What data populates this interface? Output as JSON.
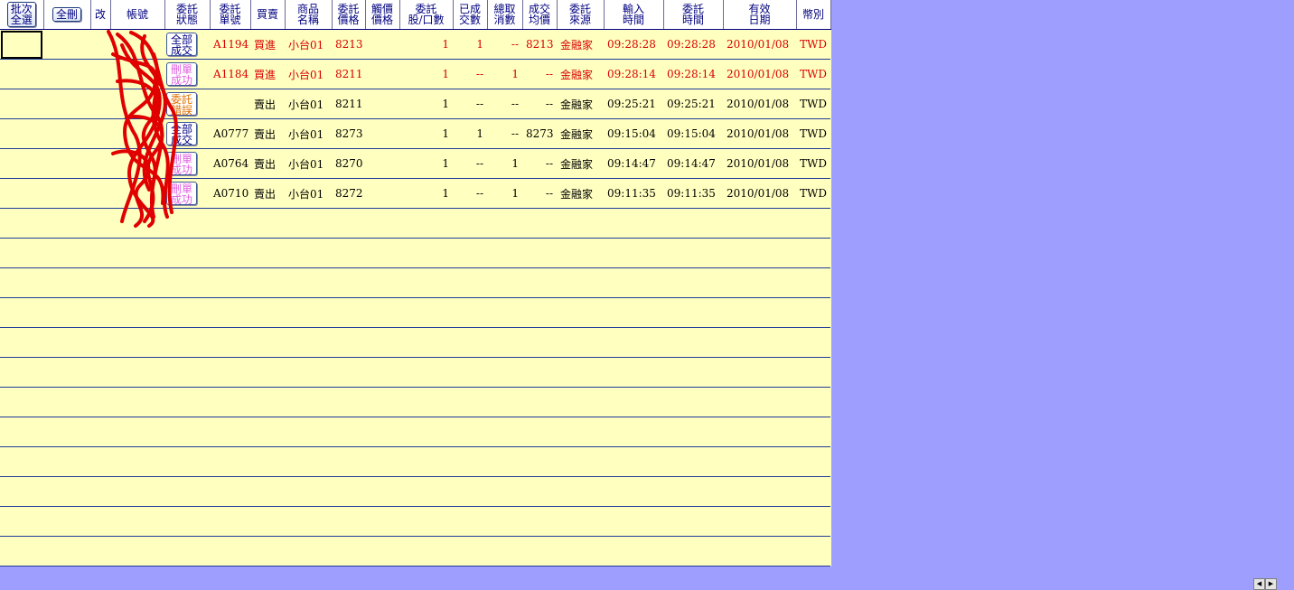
{
  "header": {
    "batch_select": "批次\n全選",
    "delete_all": "全刪",
    "modify": "改",
    "account": "帳號",
    "order_status": "委託\n狀態",
    "order_no": "委託\n單號",
    "buy_sell": "買賣",
    "product_name": "商品\n名稱",
    "order_price": "委託\n價格",
    "trigger_price": "觸價\n價格",
    "order_qty": "委託\n股/口數",
    "filled_qty": "已成\n交數",
    "cancelled_qty": "總取\n消數",
    "avg_price": "成交\n均價",
    "source": "委託\n來源",
    "input_time": "輸入\n時間",
    "order_time": "委託\n時間",
    "valid_date": "有效\n日期",
    "currency": "幣別"
  },
  "colors": {
    "status_filled": "#000080",
    "status_cancelled": "#e060e0",
    "status_error": "#e07000",
    "row_red": "#d80000"
  },
  "rows": [
    {
      "status": "全部\n成交",
      "status_type": "filled",
      "order_no": "A1194",
      "side": "買進",
      "product": "小台01",
      "price": "8213",
      "trigger": "",
      "qty": "1",
      "filled": "1",
      "cancelled": "--",
      "avg": "8213",
      "source": "金融家",
      "input_time": "09:28:28",
      "order_time": "09:28:28",
      "date": "2010/01/08",
      "currency": "TWD",
      "red": true
    },
    {
      "status": "刪單\n成功",
      "status_type": "cancelled",
      "order_no": "A1184",
      "side": "買進",
      "product": "小台01",
      "price": "8211",
      "trigger": "",
      "qty": "1",
      "filled": "--",
      "cancelled": "1",
      "avg": "--",
      "source": "金融家",
      "input_time": "09:28:14",
      "order_time": "09:28:14",
      "date": "2010/01/08",
      "currency": "TWD",
      "red": true
    },
    {
      "status": "委託\n錯誤",
      "status_type": "error",
      "order_no": "",
      "side": "賣出",
      "product": "小台01",
      "price": "8211",
      "trigger": "",
      "qty": "1",
      "filled": "--",
      "cancelled": "--",
      "avg": "--",
      "source": "金融家",
      "input_time": "09:25:21",
      "order_time": "09:25:21",
      "date": "2010/01/08",
      "currency": "TWD",
      "red": false
    },
    {
      "status": "全部\n成交",
      "status_type": "filled",
      "order_no": "A0777",
      "side": "賣出",
      "product": "小台01",
      "price": "8273",
      "trigger": "",
      "qty": "1",
      "filled": "1",
      "cancelled": "--",
      "avg": "8273",
      "source": "金融家",
      "input_time": "09:15:04",
      "order_time": "09:15:04",
      "date": "2010/01/08",
      "currency": "TWD",
      "red": false
    },
    {
      "status": "刪單\n成功",
      "status_type": "cancelled",
      "order_no": "A0764",
      "side": "賣出",
      "product": "小台01",
      "price": "8270",
      "trigger": "",
      "qty": "1",
      "filled": "--",
      "cancelled": "1",
      "avg": "--",
      "source": "金融家",
      "input_time": "09:14:47",
      "order_time": "09:14:47",
      "date": "2010/01/08",
      "currency": "TWD",
      "red": false
    },
    {
      "status": "刪單\n成功",
      "status_type": "cancelled",
      "order_no": "A0710",
      "side": "賣出",
      "product": "小台01",
      "price": "8272",
      "trigger": "",
      "qty": "1",
      "filled": "--",
      "cancelled": "1",
      "avg": "--",
      "source": "金融家",
      "input_time": "09:11:35",
      "order_time": "09:11:35",
      "date": "2010/01/08",
      "currency": "TWD",
      "red": false
    }
  ],
  "scroll": {
    "left_icon": "arrow-left-icon",
    "right_icon": "arrow-right-icon",
    "left": "◀",
    "right": "▶"
  }
}
